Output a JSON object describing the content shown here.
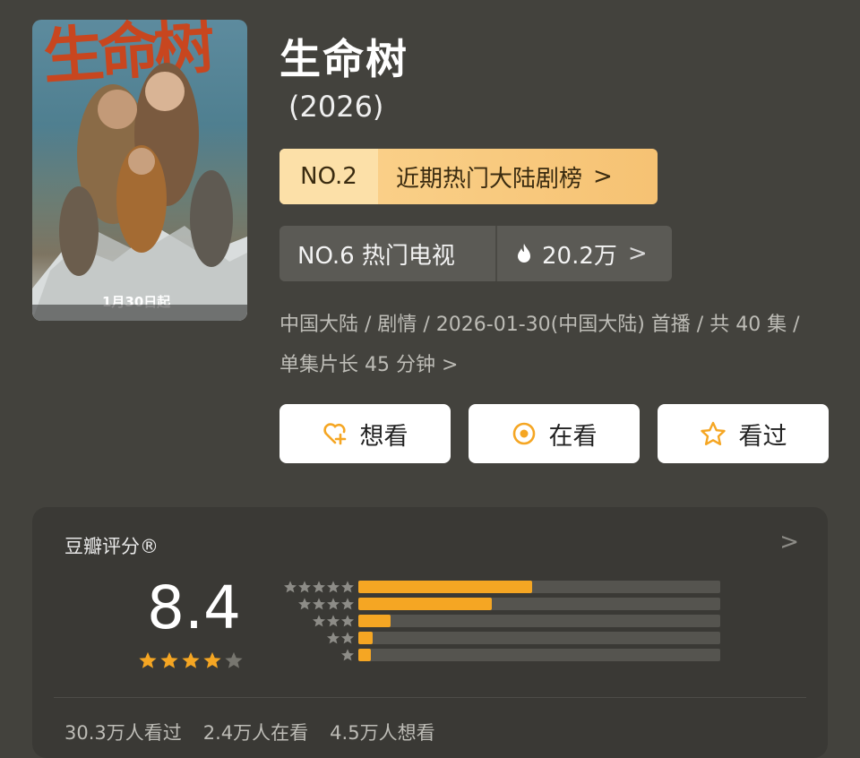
{
  "poster": {
    "title_art": "生命树",
    "tagline": "1月30日起"
  },
  "title": "生命树",
  "year": "(2026)",
  "rank_primary": {
    "number": "NO.2",
    "label": "近期热门大陆剧榜",
    "chevron": ">"
  },
  "rank_secondary": {
    "number_label": "NO.6 热门电视",
    "heat": "20.2万",
    "chevron": ">"
  },
  "meta": "中国大陆 / 剧情 / 2026-01-30(中国大陆) 首播 / 共 40 集 / 单集片长 45 分钟 >",
  "actions": [
    {
      "label": "想看",
      "icon": "heart-plus-icon"
    },
    {
      "label": "在看",
      "icon": "target-icon"
    },
    {
      "label": "看过",
      "icon": "star-outline-icon"
    }
  ],
  "rating": {
    "heading": "豆瓣评分®",
    "score": "8.4",
    "stars_filled": 4,
    "stars_total": 5,
    "distribution": [
      {
        "stars": 5,
        "fraction": 0.48
      },
      {
        "stars": 4,
        "fraction": 0.37
      },
      {
        "stars": 3,
        "fraction": 0.09
      },
      {
        "stars": 2,
        "fraction": 0.04
      },
      {
        "stars": 1,
        "fraction": 0.035
      }
    ],
    "chevron": ">"
  },
  "stats": [
    "30.3万人看过",
    "2.4万人在看",
    "4.5万人想看"
  ],
  "colors": {
    "background": "#43423d",
    "accent": "#f5a623",
    "rank_gold": "#f6c273"
  }
}
